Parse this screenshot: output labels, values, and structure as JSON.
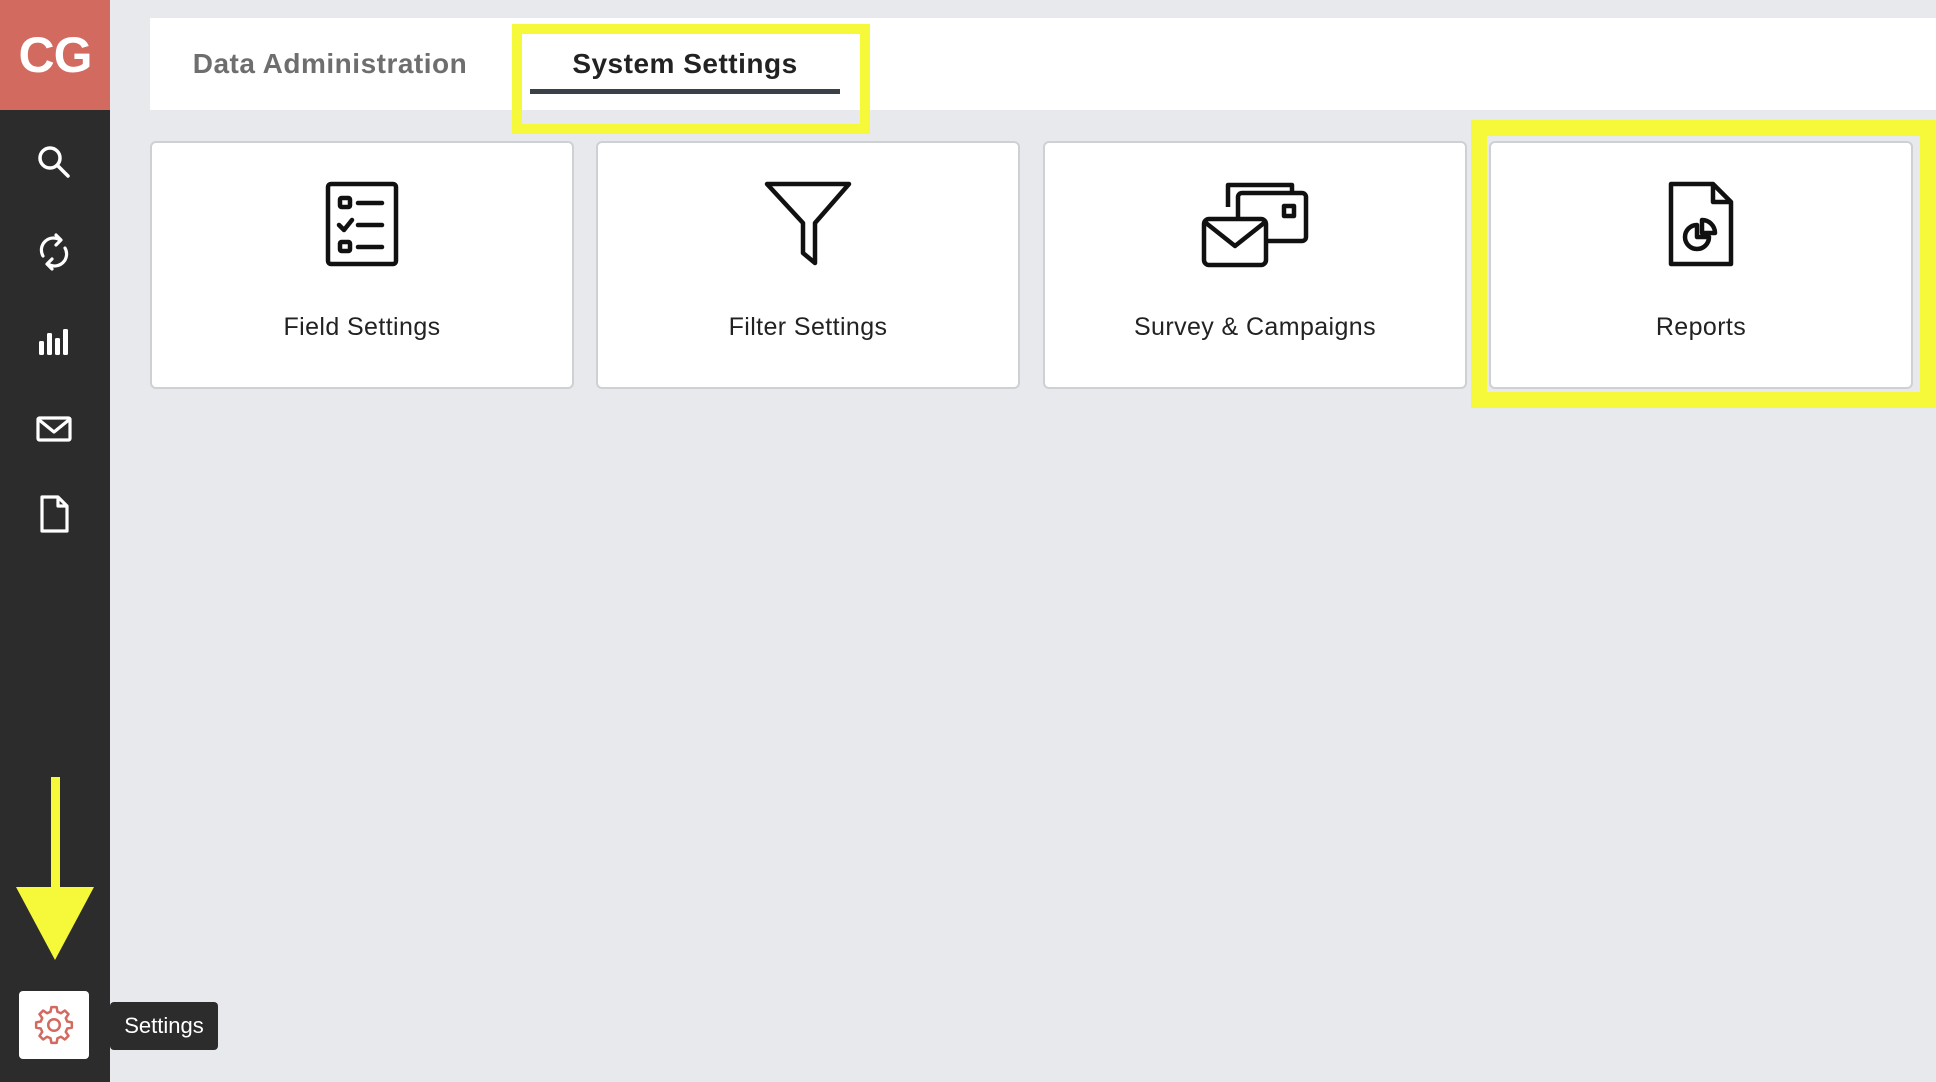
{
  "app": {
    "logo_text": "CG"
  },
  "sidebar": {
    "items": [
      {
        "icon": "search-icon"
      },
      {
        "icon": "refresh-icon"
      },
      {
        "icon": "bar-chart-icon"
      },
      {
        "icon": "mail-icon"
      },
      {
        "icon": "document-icon"
      }
    ],
    "settings_icon": "gear-icon",
    "settings_tooltip": "Settings"
  },
  "tabs": [
    {
      "label": "Data Administration",
      "active": false
    },
    {
      "label": "System Settings",
      "active": true
    }
  ],
  "cards": [
    {
      "label": "Field Settings",
      "icon": "checklist-icon"
    },
    {
      "label": "Filter Settings",
      "icon": "funnel-icon"
    },
    {
      "label": "Survey & Campaigns",
      "icon": "envelopes-icon"
    },
    {
      "label": "Reports",
      "icon": "report-document-icon"
    }
  ],
  "colors": {
    "accent": "#d26a5f",
    "sidebar": "#2c2c2c",
    "highlight": "#f6f93a",
    "background": "#e8e9ed"
  }
}
